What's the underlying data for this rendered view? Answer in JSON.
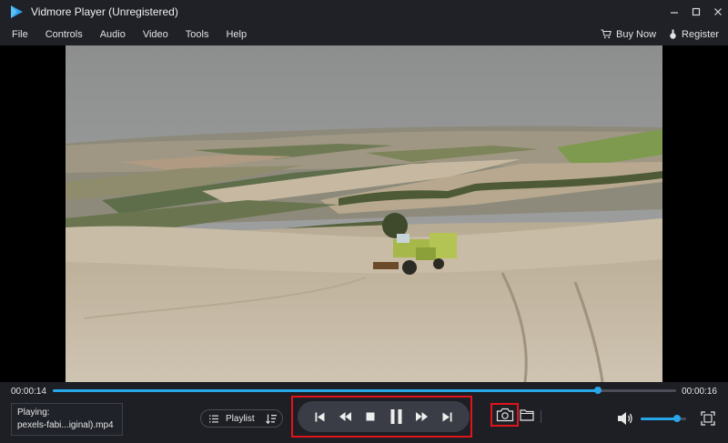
{
  "window": {
    "title": "Vidmore Player (Unregistered)"
  },
  "menu": {
    "items": [
      "File",
      "Controls",
      "Audio",
      "Video",
      "Tools",
      "Help"
    ],
    "buy_now": "Buy Now",
    "register": "Register"
  },
  "playback": {
    "current_time": "00:00:14",
    "total_time": "00:00:16",
    "progress_fraction": 0.875,
    "volume_fraction": 0.8
  },
  "now_playing": {
    "label": "Playing:",
    "filename": "pexels-fabi...iginal).mp4"
  },
  "controls": {
    "playlist_label": "Playlist"
  },
  "icons": {
    "logo": "play-logo-icon",
    "minimize": "minimize-icon",
    "maximize": "maximize-icon",
    "close": "close-icon",
    "cart": "cart-icon",
    "key": "key-icon",
    "previous": "skip-previous-icon",
    "rewind": "rewind-icon",
    "stop": "stop-icon",
    "pause": "pause-icon",
    "forward": "fast-forward-icon",
    "next": "skip-next-icon",
    "snapshot": "camera-icon",
    "folder": "folder-icon",
    "volume": "volume-icon",
    "fullscreen": "fullscreen-icon"
  },
  "colors": {
    "accent": "#27a7e8",
    "highlight": "#e0141b",
    "background": "#1d1f24"
  }
}
